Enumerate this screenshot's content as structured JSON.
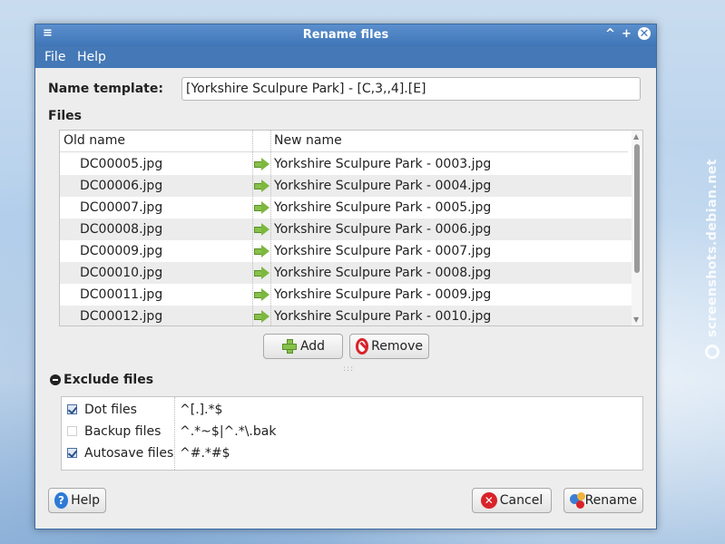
{
  "window": {
    "title": "Rename files",
    "menu_icon": "≡",
    "btn_min": "^",
    "btn_max": "+",
    "btn_close": "✕"
  },
  "menubar": {
    "file": "File",
    "help": "Help"
  },
  "name_template": {
    "label": "Name template:",
    "value": "[Yorkshire Sculpure Park] - [C,3,,4].[E]"
  },
  "files": {
    "label": "Files",
    "columns": {
      "old": "Old name",
      "new": "New name"
    },
    "rows": [
      {
        "old": "DC00005.jpg",
        "new": "Yorkshire Sculpure Park - 0003.jpg"
      },
      {
        "old": "DC00006.jpg",
        "new": "Yorkshire Sculpure Park - 0004.jpg"
      },
      {
        "old": "DC00007.jpg",
        "new": "Yorkshire Sculpure Park - 0005.jpg"
      },
      {
        "old": "DC00008.jpg",
        "new": "Yorkshire Sculpure Park - 0006.jpg"
      },
      {
        "old": "DC00009.jpg",
        "new": "Yorkshire Sculpure Park - 0007.jpg"
      },
      {
        "old": "DC00010.jpg",
        "new": "Yorkshire Sculpure Park - 0008.jpg"
      },
      {
        "old": "DC00011.jpg",
        "new": "Yorkshire Sculpure Park - 0009.jpg"
      },
      {
        "old": "DC00012.jpg",
        "new": "Yorkshire Sculpure Park - 0010.jpg"
      }
    ],
    "add_label": "Add",
    "remove_label": "Remove"
  },
  "exclude": {
    "label": "Exclude files",
    "rows": [
      {
        "label": "Dot files",
        "pattern": "^[.].*$",
        "checked": true
      },
      {
        "label": "Backup files",
        "pattern": "^.*~$|^.*\\.bak",
        "checked": false
      },
      {
        "label": "Autosave files",
        "pattern": "^#.*#$",
        "checked": true
      }
    ]
  },
  "buttons": {
    "help": "Help",
    "cancel": "Cancel",
    "rename": "Rename"
  },
  "watermark": "screenshots.debian.net",
  "icons": {
    "help": "help-icon",
    "cancel": "cancel-icon",
    "rename": "rename-icon",
    "add": "plus-icon",
    "remove": "no-entry-icon",
    "arrow": "right-arrow-icon"
  },
  "colors": {
    "titlebar": "#4478b6",
    "accent_green": "#86c14a",
    "accent_red": "#d8232a"
  }
}
